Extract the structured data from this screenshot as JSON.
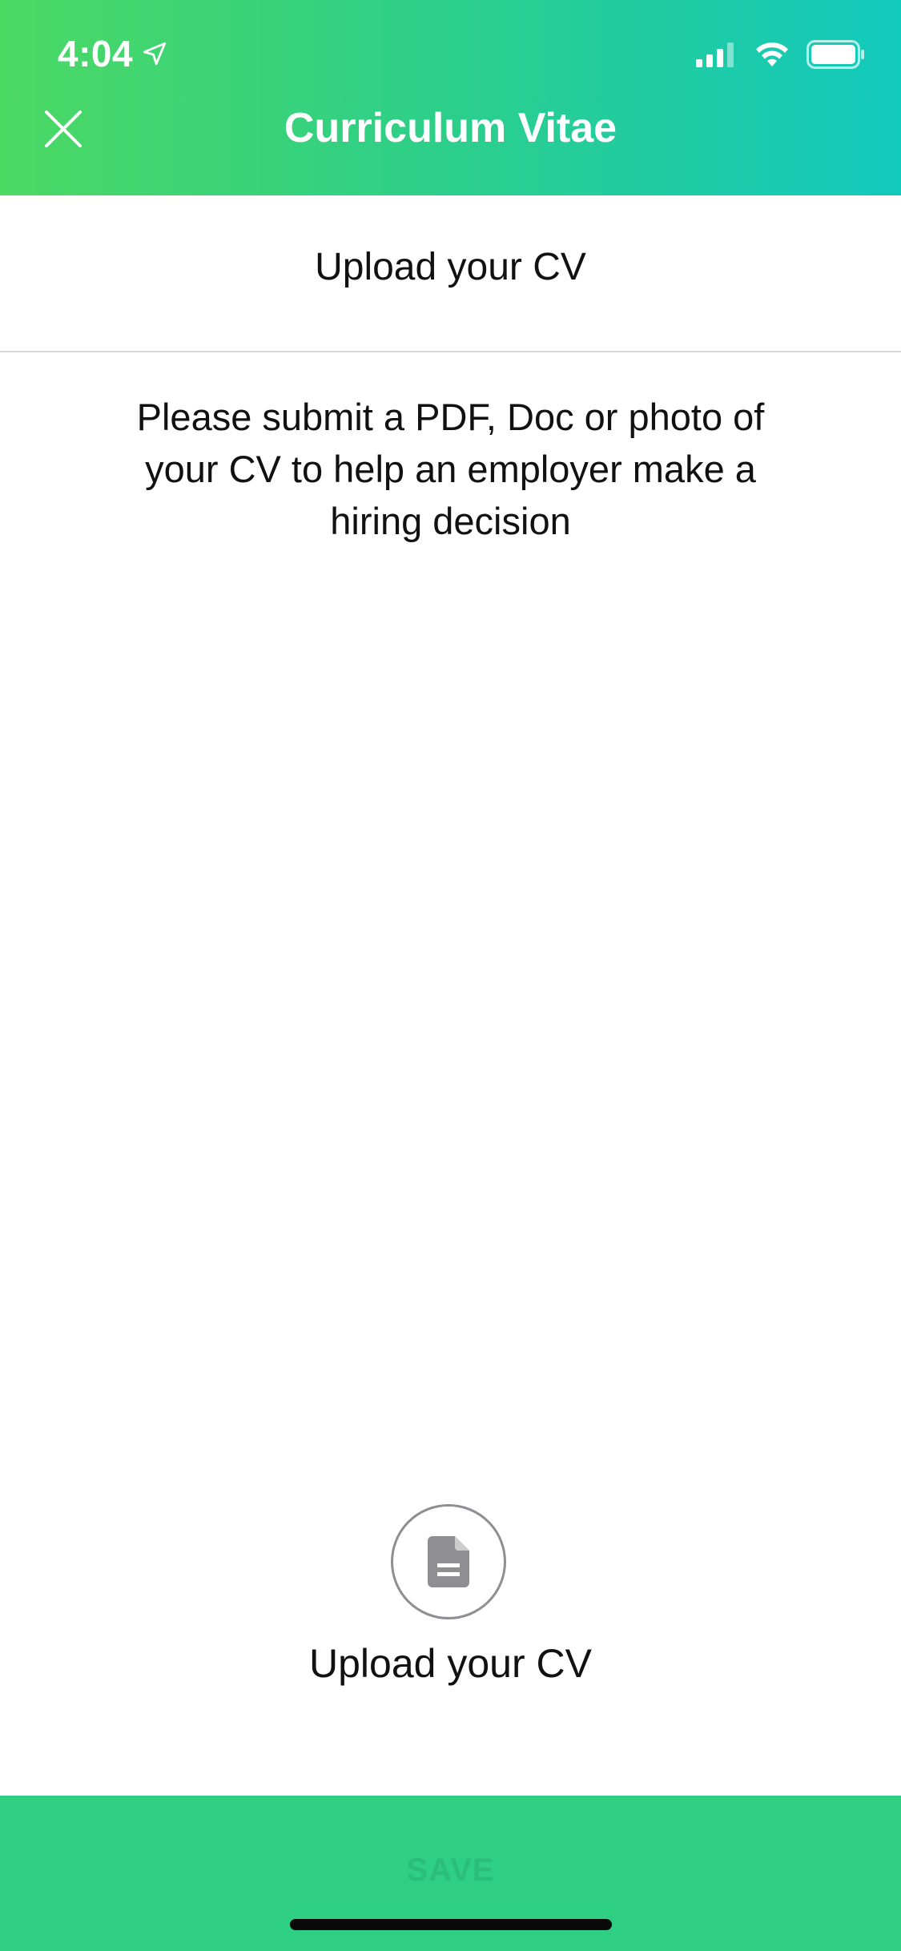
{
  "status_bar": {
    "time": "4:04",
    "icons": [
      "location-arrow-icon",
      "signal-icon",
      "wifi-icon",
      "battery-icon"
    ]
  },
  "nav": {
    "title": "Curriculum Vitae",
    "close_icon": "close-icon"
  },
  "section": {
    "title": "Upload your CV",
    "description": "Please submit a PDF, Doc or photo of your CV to help an employer make a hiring decision"
  },
  "upload": {
    "icon": "document-icon",
    "label": "Upload your CV"
  },
  "footer": {
    "save_label": "SAVE"
  },
  "colors": {
    "gradient_start": "#4cd964",
    "gradient_end": "#12c9bd",
    "save_bar": "#2ecf83"
  }
}
